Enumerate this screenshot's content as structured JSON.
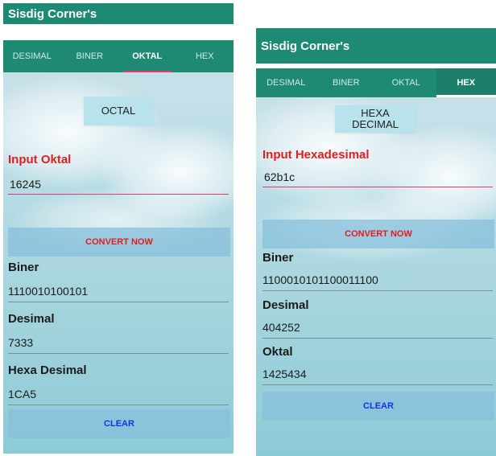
{
  "left": {
    "app_title": "Sisdig Corner's",
    "tabs": [
      "DESIMAL",
      "BINER",
      "OKTAL",
      "HEX"
    ],
    "active_tab": "OKTAL",
    "badge": "OCTAL",
    "input_label": "Input Oktal",
    "input_value": "16245",
    "convert_label": "CONVERT NOW",
    "outputs": [
      {
        "label": "Biner",
        "value": "1110010100101"
      },
      {
        "label": "Desimal",
        "value": "7333"
      },
      {
        "label": "Hexa Desimal",
        "value": "1CA5"
      }
    ],
    "clear_label": "CLEAR"
  },
  "right": {
    "app_title": "Sisdig Corner's",
    "tabs": [
      "DESIMAL",
      "BINER",
      "OKTAL",
      "HEX"
    ],
    "active_tab": "HEX",
    "badge_line1": "HEXA",
    "badge_line2": "DECIMAL",
    "input_label": "Input Hexadesimal",
    "input_value": "62b1c",
    "convert_label": "CONVERT NOW",
    "outputs": [
      {
        "label": "Biner",
        "value": "1100010101100011100"
      },
      {
        "label": "Desimal",
        "value": "404252"
      },
      {
        "label": "Oktal",
        "value": "1425434"
      }
    ],
    "clear_label": "CLEAR"
  },
  "colors": {
    "appbar": "#1f8a73",
    "tab_indicator_left": "#e53a6e",
    "input_label": "#e41d1d",
    "convert_text": "#e41d1d",
    "clear_text": "#1b2fe0",
    "button_bg": "#87c0dc",
    "badge_bg": "#b8e3ec"
  }
}
